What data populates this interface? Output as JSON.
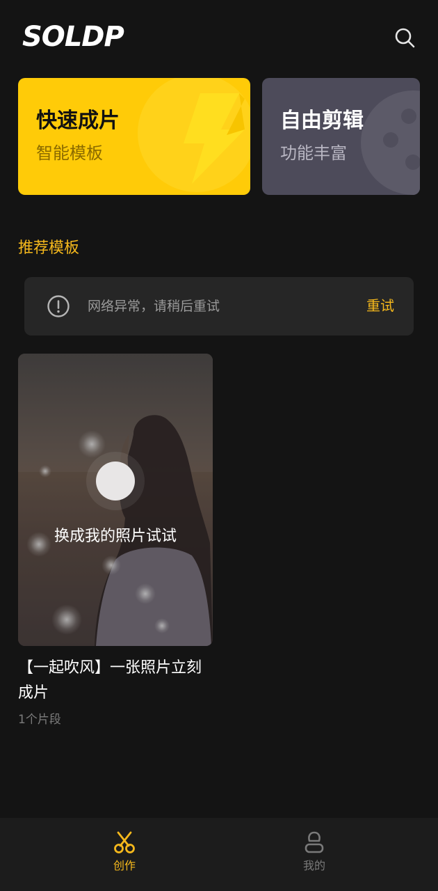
{
  "header": {
    "logo_text": "SOLDP",
    "search_icon": "search-icon"
  },
  "feature_cards": [
    {
      "title": "快速成片",
      "subtitle": "智能模板",
      "icon": "lightning-icon",
      "color": "#ffcb08"
    },
    {
      "title": "自由剪辑",
      "subtitle": "功能丰富",
      "icon": "film-reel-icon",
      "color": "#4d4b5a"
    }
  ],
  "section": {
    "title": "推荐模板"
  },
  "error_banner": {
    "icon": "alert-circle-icon",
    "message": "网络异常，请稍后重试",
    "retry_label": "重试"
  },
  "templates": [
    {
      "thumb_caption": "换成我的照片试试",
      "title": "【一起吹风】一张照片立刻成片",
      "meta": "1个片段"
    }
  ],
  "bottom_nav": {
    "items": [
      {
        "label": "创作",
        "icon": "scissors-icon",
        "active": true
      },
      {
        "label": "我的",
        "icon": "user-icon",
        "active": false
      }
    ]
  },
  "colors": {
    "accent": "#f5b81c",
    "background": "#141414",
    "banner_bg": "#262626"
  }
}
